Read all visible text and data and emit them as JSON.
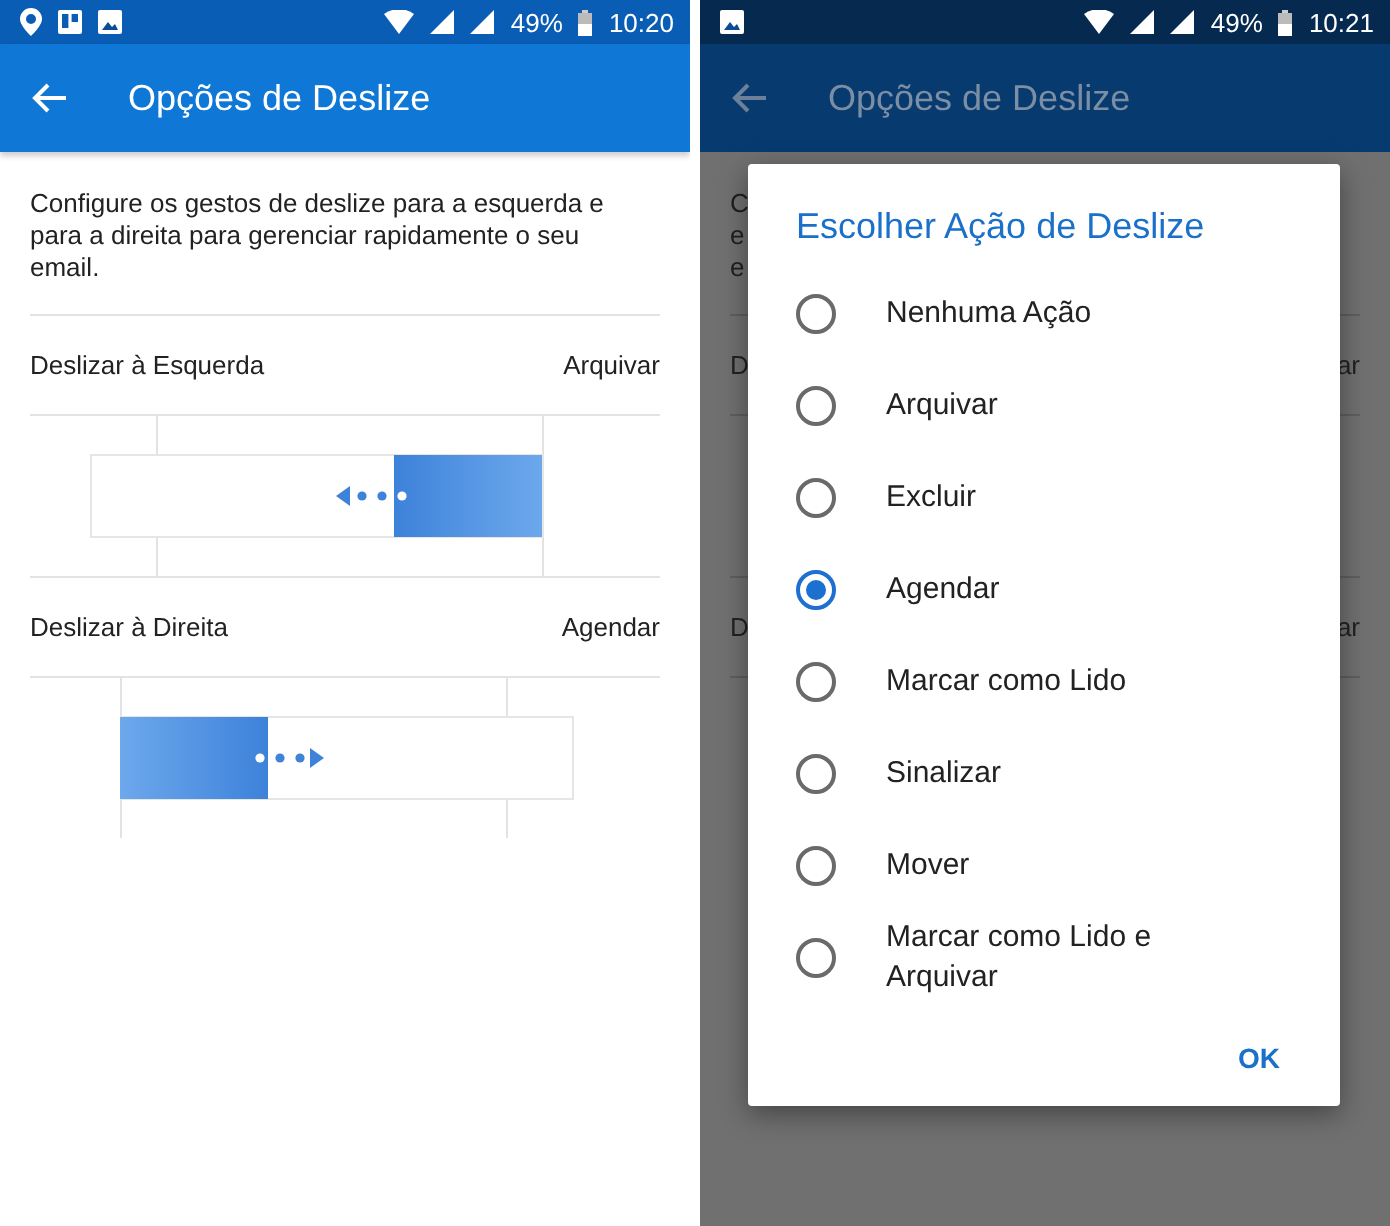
{
  "settings_screen": {
    "status_bar": {
      "battery": "49%",
      "time": "10:20"
    },
    "app_bar": {
      "title": "Opções de Deslize"
    },
    "description": "Configure os gestos de deslize para a esquerda e para a direita para gerenciar rapidamente o seu email.",
    "swipe_options": [
      {
        "label": "Deslizar à Esquerda",
        "action": "Arquivar",
        "kind": "left"
      },
      {
        "label": "Deslizar à Direita",
        "action": "Agendar",
        "kind": "right"
      }
    ]
  },
  "dialog_screen": {
    "status_bar": {
      "battery": "49%",
      "time": "10:21"
    },
    "app_bar": {
      "title": "Opções de Deslize"
    },
    "background_fragments": {
      "description_lines": [
        "C",
        "e",
        "e"
      ],
      "rows": [
        {
          "label": "D",
          "action": "ar"
        },
        {
          "label": "D",
          "action": "ar"
        }
      ]
    },
    "dialog": {
      "title": "Escolher Ação de Deslize",
      "options": [
        {
          "label": "Nenhuma Ação",
          "selected": false
        },
        {
          "label": "Arquivar",
          "selected": false
        },
        {
          "label": "Excluir",
          "selected": false
        },
        {
          "label": "Agendar",
          "selected": true
        },
        {
          "label": "Marcar como Lido",
          "selected": false
        },
        {
          "label": "Sinalizar",
          "selected": false
        },
        {
          "label": "Mover",
          "selected": false
        },
        {
          "label": "Marcar como Lido e Arquivar",
          "selected": false
        }
      ],
      "button": "OK"
    }
  }
}
